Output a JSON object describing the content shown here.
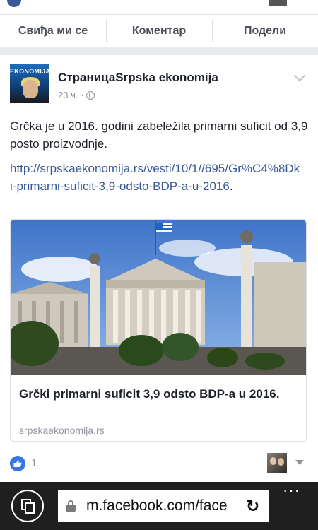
{
  "actions": {
    "like_label": "Свиђа ми се",
    "comment_label": "Коментар",
    "share_label": "Подели"
  },
  "post": {
    "avatar_text": "EKONOMIJA",
    "author": "СтраницаSrpska ekonomija",
    "time": "23 ч. ·",
    "text": "Grčka je u 2016. godini zabeležila primarni suficit od 3,9 posto proizvodnje.",
    "link": "http://srpskaekonomija.rs/vesti/10/1//695/Gr%C4%8Dki-primarni-suficit-3,9-odsto-BDP-a-u-2016",
    "link_period": ".",
    "preview": {
      "title": "Grčki primarni suficit 3,9 odsto BDP-a u 2016.",
      "domain": "srpskaekonomija.rs"
    },
    "like_count": "1"
  },
  "browser": {
    "url": "m.facebook.com/face"
  },
  "colors": {
    "link": "#365899",
    "like_blue": "#3578e5",
    "browser_bar": "#1f1f1f"
  }
}
